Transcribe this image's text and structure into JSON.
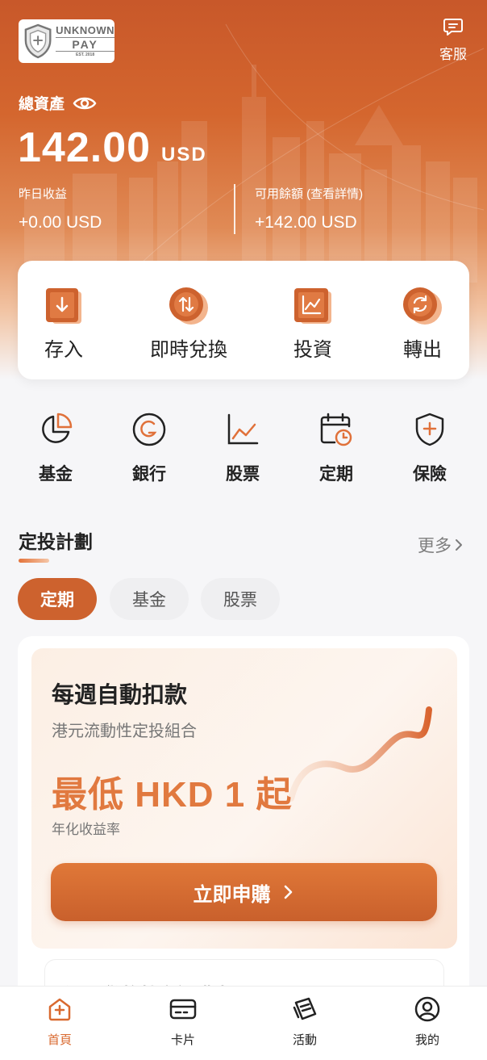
{
  "header": {
    "logo_text_1": "UNKNOWN",
    "logo_text_2": "PAY",
    "logo_text_3": "EST. 2018",
    "support_label": "客服"
  },
  "balance": {
    "total_label": "總資產",
    "amount": "142.00",
    "currency": "USD",
    "yesterday_label": "昨日收益",
    "yesterday_value": "+0.00 USD",
    "available_label": "可用餘額 (查看詳情)",
    "available_value": "+142.00 USD"
  },
  "quick_actions": [
    {
      "label": "存入",
      "icon": "deposit-icon"
    },
    {
      "label": "即時兌換",
      "icon": "exchange-icon"
    },
    {
      "label": "投資",
      "icon": "invest-chart-icon"
    },
    {
      "label": "轉出",
      "icon": "transfer-out-icon"
    }
  ],
  "categories": [
    {
      "label": "基金",
      "icon": "pie-chart-icon"
    },
    {
      "label": "銀行",
      "icon": "bank-g-icon"
    },
    {
      "label": "股票",
      "icon": "stock-chart-icon"
    },
    {
      "label": "定期",
      "icon": "calendar-clock-icon"
    },
    {
      "label": "保險",
      "icon": "shield-plus-icon"
    }
  ],
  "plan_section": {
    "title": "定投計劃",
    "more_label": "更多",
    "chips": [
      "定期",
      "基金",
      "股票"
    ],
    "active_chip": 0
  },
  "plan_card": {
    "title": "每週自動扣款",
    "subtitle": "港元流動性定投組合",
    "headline": "最低 HKD 1 起",
    "rate_label": "年化收益率",
    "cta_label": "立即申購"
  },
  "next_card_peek": "港元貨幣基金認購中",
  "tabbar": [
    {
      "label": "首頁",
      "icon": "home-icon"
    },
    {
      "label": "卡片",
      "icon": "card-icon"
    },
    {
      "label": "活動",
      "icon": "activity-icon"
    },
    {
      "label": "我的",
      "icon": "profile-icon"
    }
  ],
  "active_tab": 0,
  "colors": {
    "accent": "#cd622e",
    "accent_light": "#e1793f",
    "hero_top": "#c8582a"
  }
}
